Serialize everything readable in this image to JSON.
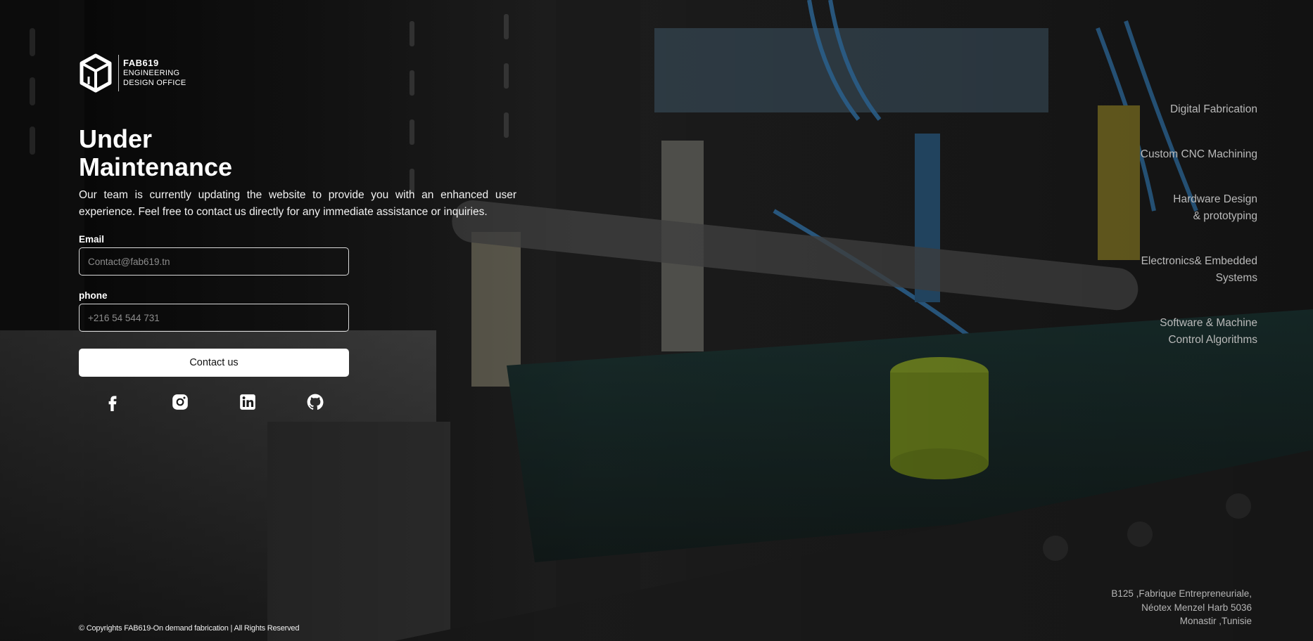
{
  "logo": {
    "name": "FAB619",
    "line1": "ENGINEERING",
    "line2": "DESIGN OFFICE"
  },
  "hero": {
    "title_line1": "Under",
    "title_line2": "Maintenance",
    "description": "Our team is currently updating the website to provide you with an enhanced user experience. Feel free to contact us directly for any immediate assistance or inquiries."
  },
  "form": {
    "email_label": "Email",
    "email_placeholder": "Contact@fab619.tn",
    "phone_label": "phone",
    "phone_placeholder": "+216 54 544 731",
    "contact_button": "Contact us"
  },
  "social": [
    {
      "icon": "facebook-icon"
    },
    {
      "icon": "instagram-icon"
    },
    {
      "icon": "linkedin-icon"
    },
    {
      "icon": "github-icon"
    }
  ],
  "services": [
    "Digital Fabrication",
    "Custom CNC Machining",
    "Hardware Design\n& prototyping",
    "Electronics& Embedded\nSystems",
    "Software & Machine\nControl Algorithms"
  ],
  "address": {
    "line1": "B125 ,Fabrique Entrepreneuriale,",
    "line2": "Néotex Menzel Harb 5036",
    "line3": "Monastir ,Tunisie"
  },
  "footer": {
    "copyright": "© Copyrights FAB619-On demand fabrication | All Rights Reserved"
  },
  "colors": {
    "background": "#141414",
    "text": "#ffffff",
    "muted_text": "#b9b9b9",
    "button_bg": "#ffffff",
    "accent_yellow_green": "#9cb82a",
    "cable_blue": "#3b86c4"
  }
}
